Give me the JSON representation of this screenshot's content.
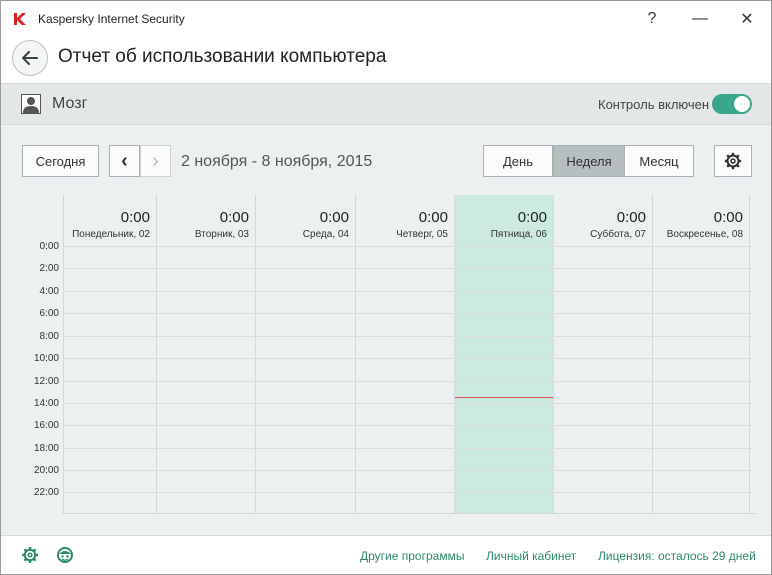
{
  "window": {
    "app_title": "Kaspersky Internet Security",
    "help_label": "?",
    "minimize_label": "—",
    "close_label": "✕"
  },
  "header": {
    "title": "Отчет об использовании компьютера"
  },
  "child": {
    "name": "Мозг",
    "control_label": "Контроль включен",
    "control_enabled": true
  },
  "toolbar": {
    "today_label": "Сегодня",
    "prev_label": "‹",
    "next_label": "›",
    "date_range": "2 ноября - 8 ноября, 2015",
    "view_day": "День",
    "view_week": "Неделя",
    "view_month": "Месяц",
    "active_view": "Неделя"
  },
  "days": [
    {
      "name": "Понедельник, 02",
      "total": "0:00"
    },
    {
      "name": "Вторник, 03",
      "total": "0:00"
    },
    {
      "name": "Среда, 04",
      "total": "0:00"
    },
    {
      "name": "Четверг, 05",
      "total": "0:00"
    },
    {
      "name": "Пятница, 06",
      "total": "0:00",
      "selected": true
    },
    {
      "name": "Суббота, 07",
      "total": "0:00"
    },
    {
      "name": "Воскресенье, 08",
      "total": "0:00"
    }
  ],
  "time_labels": [
    "0:00",
    "2:00",
    "4:00",
    "6:00",
    "8:00",
    "10:00",
    "12:00",
    "14:00",
    "16:00",
    "18:00",
    "20:00",
    "22:00"
  ],
  "footer": {
    "other_programs": "Другие программы",
    "personal_cabinet": "Личный кабинет",
    "license": "Лицензия: осталось 29 дней"
  },
  "colors": {
    "accent": "#2b8a6e",
    "toggle_on": "#3aa58a",
    "selected_day": "#cdeae2",
    "now_line": "#d9534f"
  }
}
